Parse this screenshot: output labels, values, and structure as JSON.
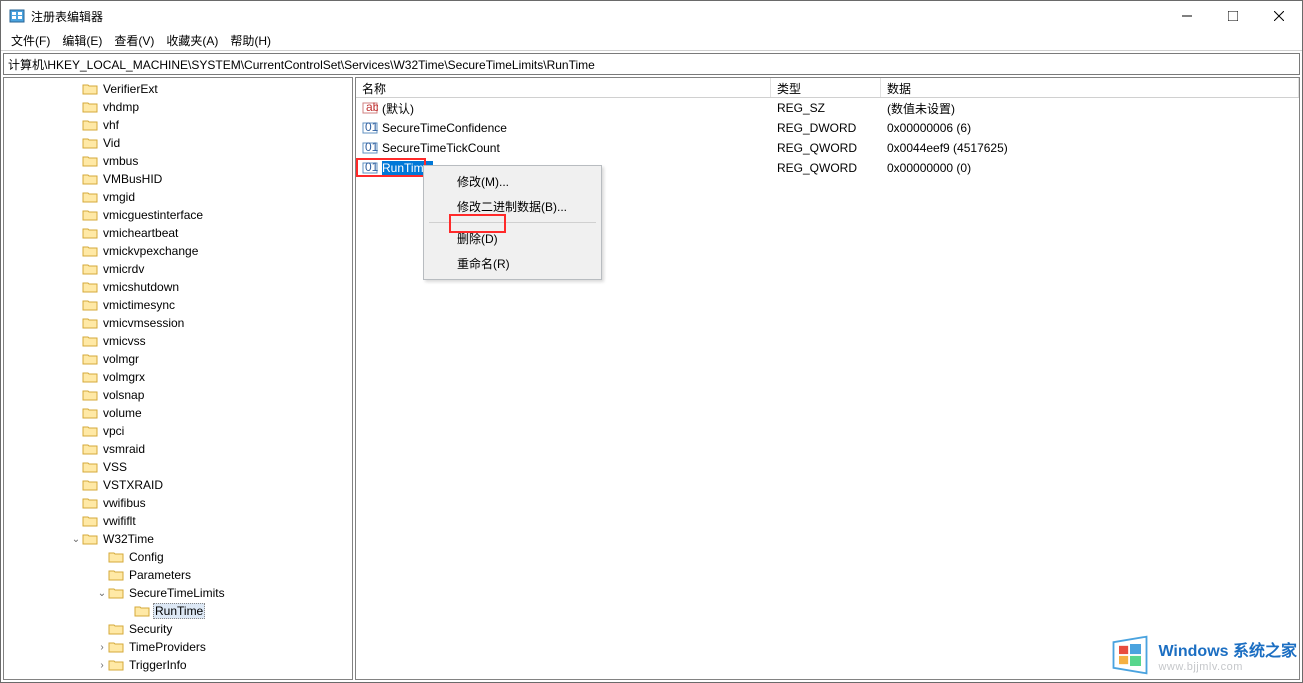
{
  "window": {
    "title": "注册表编辑器"
  },
  "menu": {
    "file": "文件(F)",
    "edit": "编辑(E)",
    "view": "查看(V)",
    "fav": "收藏夹(A)",
    "help": "帮助(H)"
  },
  "address": "计算机\\HKEY_LOCAL_MACHINE\\SYSTEM\\CurrentControlSet\\Services\\W32Time\\SecureTimeLimits\\RunTime",
  "tree": [
    {
      "label": "VerifierExt",
      "indent": 66
    },
    {
      "label": "vhdmp",
      "indent": 66
    },
    {
      "label": "vhf",
      "indent": 66
    },
    {
      "label": "Vid",
      "indent": 66
    },
    {
      "label": "vmbus",
      "indent": 66
    },
    {
      "label": "VMBusHID",
      "indent": 66
    },
    {
      "label": "vmgid",
      "indent": 66
    },
    {
      "label": "vmicguestinterface",
      "indent": 66
    },
    {
      "label": "vmicheartbeat",
      "indent": 66
    },
    {
      "label": "vmickvpexchange",
      "indent": 66
    },
    {
      "label": "vmicrdv",
      "indent": 66
    },
    {
      "label": "vmicshutdown",
      "indent": 66
    },
    {
      "label": "vmictimesync",
      "indent": 66
    },
    {
      "label": "vmicvmsession",
      "indent": 66
    },
    {
      "label": "vmicvss",
      "indent": 66
    },
    {
      "label": "volmgr",
      "indent": 66
    },
    {
      "label": "volmgrx",
      "indent": 66
    },
    {
      "label": "volsnap",
      "indent": 66
    },
    {
      "label": "volume",
      "indent": 66
    },
    {
      "label": "vpci",
      "indent": 66
    },
    {
      "label": "vsmraid",
      "indent": 66
    },
    {
      "label": "VSS",
      "indent": 66
    },
    {
      "label": "VSTXRAID",
      "indent": 66
    },
    {
      "label": "vwifibus",
      "indent": 66
    },
    {
      "label": "vwififlt",
      "indent": 66
    },
    {
      "label": "W32Time",
      "indent": 66,
      "toggle": "v"
    },
    {
      "label": "Config",
      "indent": 92
    },
    {
      "label": "Parameters",
      "indent": 92
    },
    {
      "label": "SecureTimeLimits",
      "indent": 92,
      "toggle": "v"
    },
    {
      "label": "RunTime",
      "indent": 118,
      "selected": true
    },
    {
      "label": "Security",
      "indent": 92
    },
    {
      "label": "TimeProviders",
      "indent": 92,
      "toggle": ">"
    },
    {
      "label": "TriggerInfo",
      "indent": 92,
      "toggle": ">"
    }
  ],
  "columns": {
    "name": "名称",
    "type": "类型",
    "data": "数据"
  },
  "values": [
    {
      "name": "(默认)",
      "type": "REG_SZ",
      "data": "(数值未设置)",
      "icon": "str"
    },
    {
      "name": "SecureTimeConfidence",
      "type": "REG_DWORD",
      "data": "0x00000006 (6)",
      "icon": "bin"
    },
    {
      "name": "SecureTimeTickCount",
      "type": "REG_QWORD",
      "data": "0x0044eef9 (4517625)",
      "icon": "bin"
    },
    {
      "name": "RunTime",
      "type": "REG_QWORD",
      "data": "0x00000000 (0)",
      "icon": "bin",
      "selected": true
    }
  ],
  "context_menu": {
    "modify": "修改(M)...",
    "modify_binary": "修改二进制数据(B)...",
    "delete": "删除(D)",
    "rename": "重命名(R)"
  },
  "watermark": {
    "line1": "Windows 系统之家",
    "line2": "www.bjjmlv.com"
  }
}
